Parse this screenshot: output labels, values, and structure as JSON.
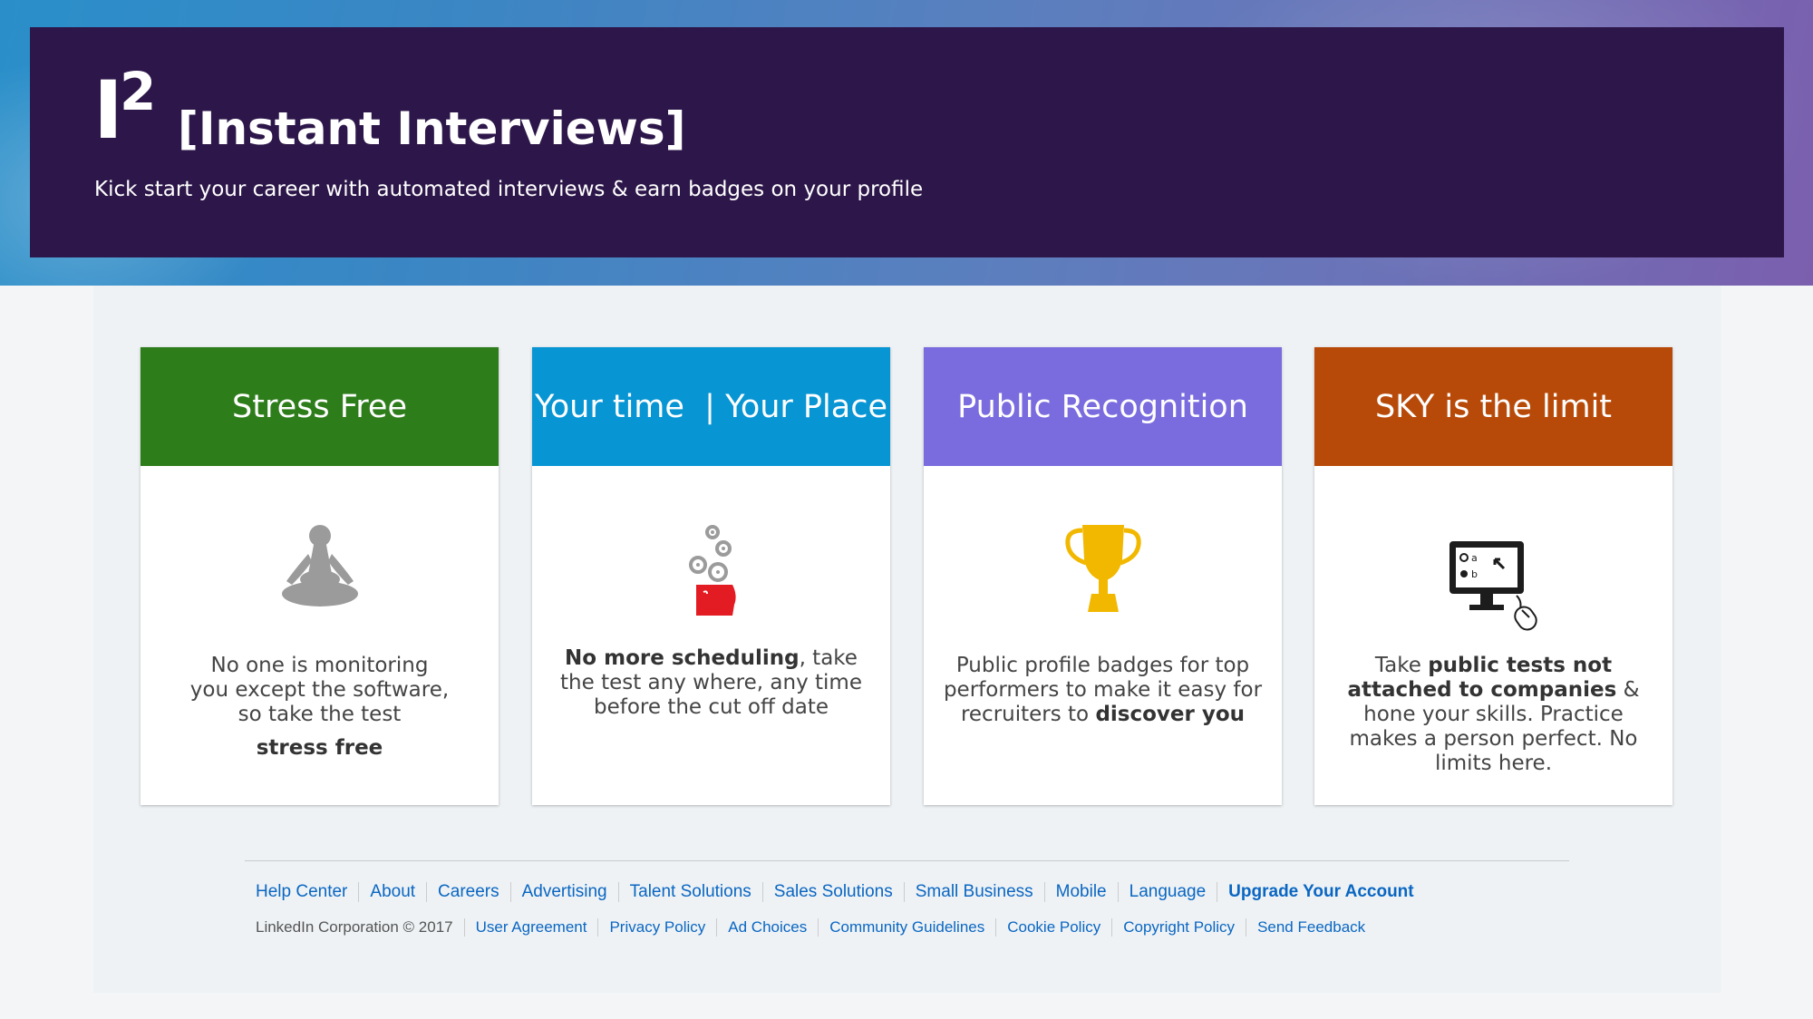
{
  "hero": {
    "logo_letter": "I",
    "logo_superscript": "2",
    "title": "[Instant Interviews]",
    "subtitle": "Kick start your career with automated interviews & earn badges on your profile"
  },
  "cards": [
    {
      "title": "Stress Free",
      "color": "#2e7d1b",
      "icon": "meditation-icon",
      "text_lines": [
        "No one is monitoring",
        "you except the software,",
        "so take the test"
      ],
      "emphasis": "stress free"
    },
    {
      "title": "Your time  | Your Place",
      "color": "#0895d3",
      "icon": "gears-head-icon",
      "bold_lead": "No more scheduling",
      "text_after": ", take the test any where, any time before the cut off date"
    },
    {
      "title": "Public Recognition",
      "color": "#7a6cde",
      "icon": "trophy-icon",
      "text": "Public profile badges for top performers to make it easy for recruiters to",
      "emphasis": "discover you"
    },
    {
      "title": "SKY is the limit",
      "color": "#b84a09",
      "icon": "computer-test-icon",
      "text_before": "Take ",
      "bold": "public tests not attached to companies",
      "text_after": " & hone your skills. Practice makes a person perfect. No limits here."
    }
  ],
  "footer": {
    "links_row1": [
      "Help Center",
      "About",
      "Careers",
      "Advertising",
      "Talent Solutions",
      "Sales Solutions",
      "Small Business",
      "Mobile",
      "Language"
    ],
    "upgrade": "Upgrade Your Account",
    "copyright": "LinkedIn Corporation © 2017",
    "links_row2": [
      "User Agreement",
      "Privacy Policy",
      "Ad Choices",
      "Community Guidelines",
      "Cookie Policy",
      "Copyright Policy",
      "Send Feedback"
    ],
    "link_color": "#0a66c2"
  }
}
